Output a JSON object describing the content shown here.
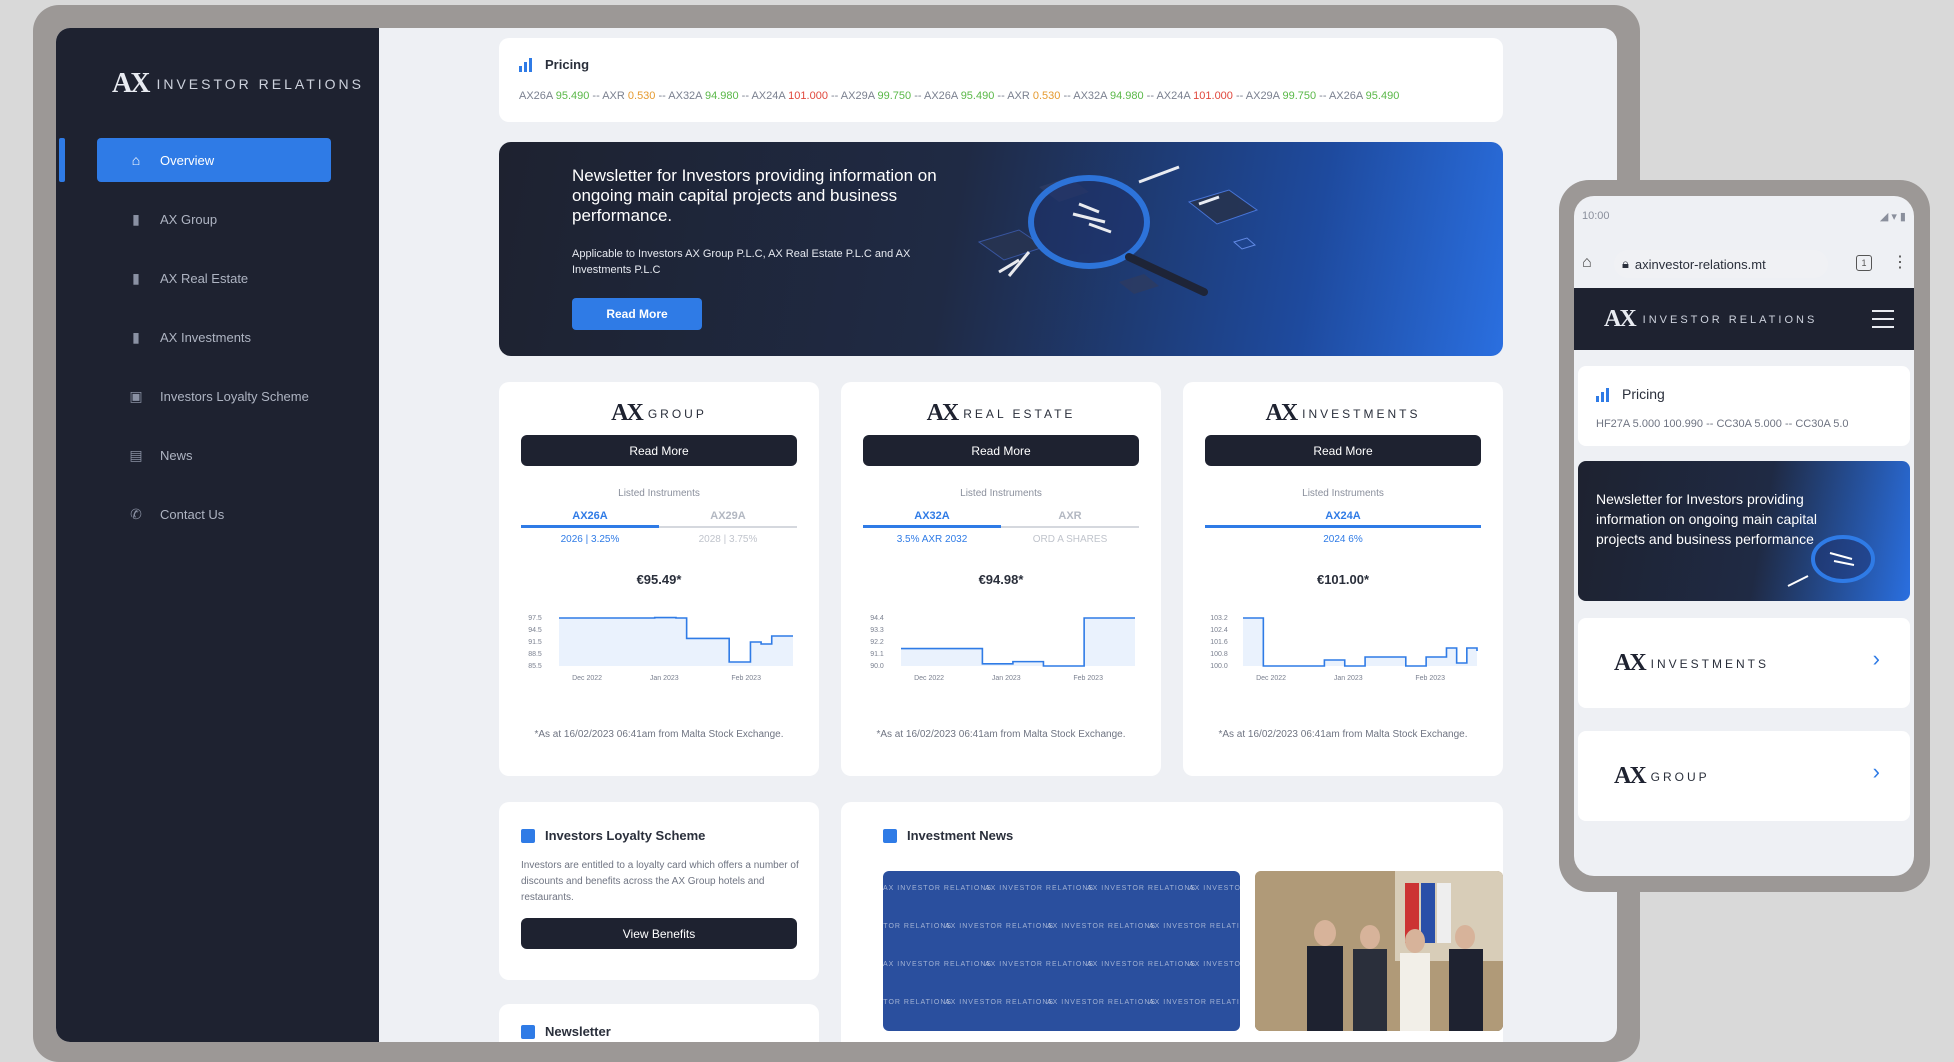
{
  "brand": {
    "mark": "AX",
    "name": "INVESTOR RELATIONS"
  },
  "sidebar": {
    "items": [
      {
        "label": "Overview",
        "icon": "home-icon"
      },
      {
        "label": "AX Group",
        "icon": "building-icon"
      },
      {
        "label": "AX Real Estate",
        "icon": "building-icon"
      },
      {
        "label": "AX Investments",
        "icon": "building-icon"
      },
      {
        "label": "Investors Loyalty Scheme",
        "icon": "card-icon"
      },
      {
        "label": "News",
        "icon": "newspaper-icon"
      },
      {
        "label": "Contact Us",
        "icon": "phone-icon"
      }
    ]
  },
  "pricing": {
    "title": "Pricing",
    "ticker": [
      {
        "sym": "AX26A",
        "val": "95.490",
        "color": "green"
      },
      {
        "sym": "AXR",
        "val": "0.530",
        "color": "orange"
      },
      {
        "sym": "AX32A",
        "val": "94.980",
        "color": "green"
      },
      {
        "sym": "AX24A",
        "val": "101.000",
        "color": "red"
      },
      {
        "sym": "AX29A",
        "val": "99.750",
        "color": "green"
      },
      {
        "sym": "AX26A",
        "val": "95.490",
        "color": "green"
      },
      {
        "sym": "AXR",
        "val": "0.530",
        "color": "orange"
      },
      {
        "sym": "AX32A",
        "val": "94.980",
        "color": "green"
      },
      {
        "sym": "AX24A",
        "val": "101.000",
        "color": "red"
      },
      {
        "sym": "AX29A",
        "val": "99.750",
        "color": "green"
      },
      {
        "sym": "AX26A",
        "val": "95.490",
        "color": "green"
      }
    ]
  },
  "banner": {
    "title": "Newsletter for Investors providing information on ongoing main capital projects and business performance.",
    "subtitle": "Applicable to Investors AX Group P.L.C, AX Real Estate P.L.C and AX Investments P.L.C",
    "button": "Read More"
  },
  "entities": [
    {
      "name": "GROUP",
      "button": "Read More",
      "listed_label": "Listed Instruments",
      "tabs": [
        "AX26A",
        "AX29A"
      ],
      "tab_subs": [
        "2026 | 3.25%",
        "2028 | 3.75%"
      ],
      "price": "€95.49*",
      "chart": {
        "yticks": [
          "97.5",
          "94.5",
          "91.5",
          "88.5",
          "85.5"
        ],
        "xticks": [
          "Dec 2022",
          "Jan 2023",
          "Feb 2023"
        ],
        "ymin": 85.5,
        "ymax": 97.5,
        "values": [
          97.5,
          97.5,
          97.5,
          97.5,
          97.5,
          97.5,
          97.5,
          97.5,
          97.5,
          97.6,
          97.6,
          97.5,
          92.4,
          92.4,
          92.4,
          92.4,
          86.5,
          86.5,
          91.5,
          91.0,
          93.0,
          93.0,
          93.0
        ]
      },
      "asof": "*As at 16/02/2023 06:41am from Malta Stock Exchange."
    },
    {
      "name": "REAL ESTATE",
      "button": "Read More",
      "listed_label": "Listed Instruments",
      "tabs": [
        "AX32A",
        "AXR"
      ],
      "tab_subs": [
        "3.5% AXR 2032",
        "ORD A SHARES"
      ],
      "price": "€94.98*",
      "chart": {
        "yticks": [
          "94.4",
          "93.3",
          "92.2",
          "91.1",
          "90.0"
        ],
        "xticks": [
          "Dec 2022",
          "Jan 2023",
          "Feb 2023"
        ],
        "ymin": 90.0,
        "ymax": 94.4,
        "values": [
          91.6,
          91.6,
          91.6,
          91.6,
          91.6,
          91.6,
          91.6,
          91.6,
          90.2,
          90.2,
          90.2,
          90.4,
          90.4,
          90.4,
          90.0,
          90.0,
          90.0,
          90.0,
          94.4,
          94.4,
          94.4,
          94.4,
          94.4,
          94.4
        ]
      },
      "asof": "*As at 16/02/2023 06:41am from Malta Stock Exchange."
    },
    {
      "name": "INVESTMENTS",
      "button": "Read More",
      "listed_label": "Listed Instruments",
      "tabs": [
        "AX24A"
      ],
      "tab_subs": [
        "2024 6%"
      ],
      "price": "€101.00*",
      "chart": {
        "yticks": [
          "103.2",
          "102.4",
          "101.6",
          "100.8",
          "100.0"
        ],
        "xticks": [
          "Dec 2022",
          "Jan 2023",
          "Feb 2023"
        ],
        "ymin": 100.0,
        "ymax": 103.2,
        "values": [
          103.2,
          103.2,
          100.0,
          100.0,
          100.0,
          100.0,
          100.0,
          100.0,
          100.4,
          100.4,
          100.0,
          100.0,
          100.6,
          100.6,
          100.6,
          100.6,
          100.0,
          100.0,
          100.6,
          100.6,
          101.2,
          100.2,
          101.2,
          101.0
        ]
      },
      "asof": "*As at 16/02/2023 06:41am from Malta Stock Exchange."
    }
  ],
  "loyalty": {
    "title": "Investors Loyalty Scheme",
    "text": "Investors are entitled to a loyalty card which offers a number of discounts and benefits across the AX Group hotels and restaurants.",
    "button": "View Benefits"
  },
  "newsletter": {
    "title": "Newsletter"
  },
  "news": {
    "title": "Investment News",
    "watermark": "INVESTOR RELATIONS"
  },
  "phone": {
    "time": "10:00",
    "url": "axinvestor-relations.mt",
    "tab_count": "1",
    "pricing_title": "Pricing",
    "ticker": "HF27A  5.000  100.990 -- CC30A  5.000 -- CC30A  5.0",
    "banner": "Newsletter for Investors providing information on ongoing main capital projects and business performance",
    "cards": [
      "INVESTMENTS",
      "GROUP"
    ]
  },
  "colors": {
    "accent": "#2f7be6",
    "dark": "#1e2230",
    "green": "#5ab848",
    "red": "#e0473c",
    "orange": "#e59a2f"
  }
}
